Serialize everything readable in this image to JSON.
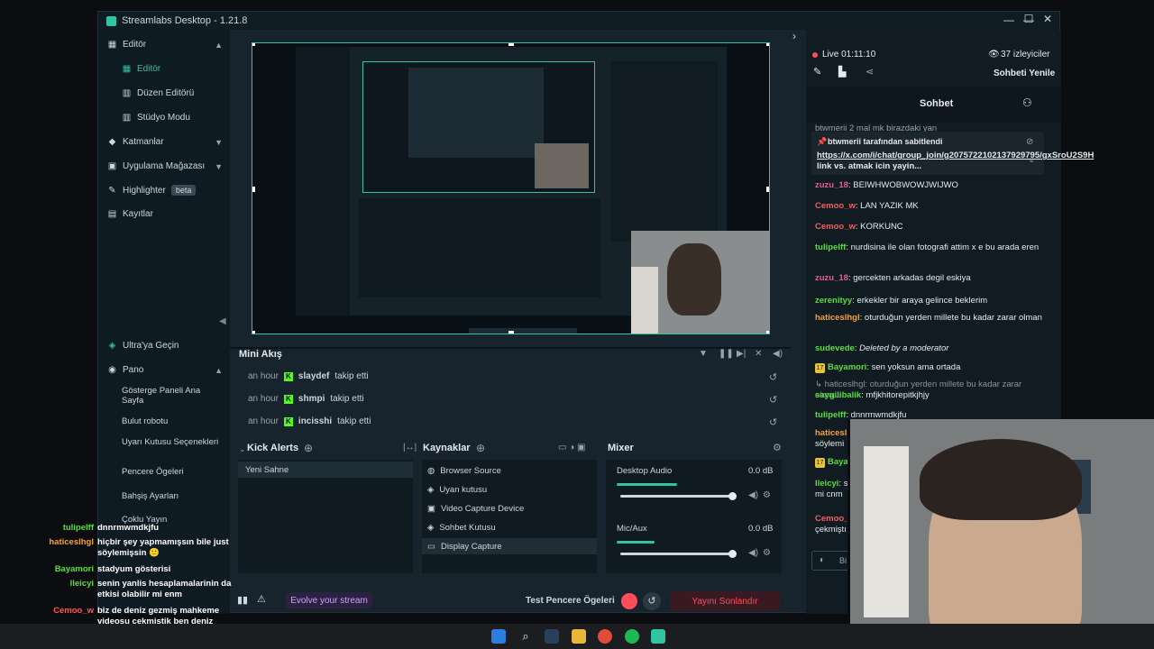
{
  "window": {
    "title": "Streamlabs Desktop - 1.21.8"
  },
  "sidebar": {
    "items": [
      {
        "label": "Editör"
      },
      {
        "label": "Editör"
      },
      {
        "label": "Düzen Editörü"
      },
      {
        "label": "Stüdyo Modu"
      },
      {
        "label": "Katmanlar"
      },
      {
        "label": "Uygulama Mağazası"
      },
      {
        "label": "Highlighter",
        "badge": "beta"
      },
      {
        "label": "Kayıtlar"
      },
      {
        "label": "Ultra'ya Geçin"
      },
      {
        "label": "Pano"
      },
      {
        "label": "Gösterge Paneli Ana Sayfa"
      },
      {
        "label": "Bulut robotu"
      },
      {
        "label": "Uyarı Kutusu Seçenekleri"
      },
      {
        "label": "Pencere Ögeleri"
      },
      {
        "label": "Bahşiş Ayarları"
      },
      {
        "label": "Çoklu Yayın"
      }
    ]
  },
  "mini_feed": {
    "title": "Mini Akış",
    "rows": [
      {
        "time": "an hour",
        "name": "slaydef",
        "action": "takip etti"
      },
      {
        "time": "an hour",
        "name": "shmpi",
        "action": "takip etti"
      },
      {
        "time": "an hour",
        "name": "incisshi",
        "action": "takip etti"
      }
    ]
  },
  "scenes": {
    "title": "Kick Alerts",
    "items": [
      "Yeni Sahne"
    ]
  },
  "sources": {
    "title": "Kaynaklar",
    "items": [
      "Browser Source",
      "Uyan kutusu",
      "Video Capture Device",
      "Sohbet Kutusu",
      "Display Capture"
    ],
    "selected": 4
  },
  "mixer": {
    "title": "Mixer",
    "channels": [
      {
        "name": "Desktop Audio",
        "db": "0.0 dB",
        "level": 0.48
      },
      {
        "name": "Mic/Aux",
        "db": "0.0 dB",
        "level": 0.3
      }
    ]
  },
  "footer": {
    "evolve": "Evolve your stream",
    "test_widgets": "Test Pencere Ögeleri",
    "end_stream": "Yayını Sonlandır"
  },
  "chat": {
    "live": "Live 01:11:10",
    "viewers": "37 izleyiciler",
    "refresh": "Sohbeti Yenile",
    "title": "Sohbet",
    "pinned_top": "btwmerii 2 mal mk birazdaki yan",
    "pinned_by": "btwmerii tarafından sabitlendi",
    "pinned_link": "https://x.com/i/chat/group_join/g2075722102137929795/gxSroU2S9H",
    "pinned_rest": " link vs. atmak icin yayin...",
    "messages": [
      {
        "user": "zuzu_18",
        "color": "#e85d8f",
        "text": "BEIWHWOBWOWJWIJWO"
      },
      {
        "user": "Cemoo_w",
        "color": "#ff5a5a",
        "text": "LAN YAZIK MK"
      },
      {
        "user": "Cemoo_w",
        "color": "#ff5a5a",
        "text": "KORKUNC"
      },
      {
        "user": "tulipelff",
        "color": "#5bde3a",
        "text": "nurdisina ile olan fotografi attim x e bu arada eren"
      },
      {
        "user": "zuzu_18",
        "color": "#e85d8f",
        "text": "gercekten arkadas degil eskiya"
      },
      {
        "user": "zerenityy",
        "color": "#5bde3a",
        "text": "erkekler bir araya gelince beklerim"
      },
      {
        "user": "haticeslhgl",
        "color": "#f2a33a",
        "text": "oturduğun yerden millete bu kadar zarar olman"
      },
      {
        "user": "sudevede",
        "color": "#5bde3a",
        "text": "Deleted by a moderator"
      },
      {
        "user": "Bayamori",
        "color": "#5bde3a",
        "text": "sen yoksun ama ortada"
      },
      {
        "user": "",
        "color": "#8a949c",
        "text": "↳ haticeslhgl: oturduğun yerden millete bu kadar zarar olma..."
      },
      {
        "user": "saygilibalik",
        "color": "#5bde3a",
        "text": "mfjkhitorepitkjhjy"
      },
      {
        "user": "tulipelff",
        "color": "#5bde3a",
        "text": "dnnrmwmdkjfu"
      },
      {
        "user": "haticesl",
        "color": "#f2a33a",
        "text": ""
      },
      {
        "user": "",
        "color": "#e6eaee",
        "text": "söylemi"
      },
      {
        "user": "Baya",
        "color": "#5bde3a",
        "text": ""
      },
      {
        "user": "lleicyi",
        "color": "#5bde3a",
        "text": "s"
      },
      {
        "user": "",
        "color": "#e6eaee",
        "text": "mi cnm"
      },
      {
        "user": "Cemoo_",
        "color": "#ff5a5a",
        "text": ""
      },
      {
        "user": "",
        "color": "#e6eaee",
        "text": "çekmiştı"
      }
    ],
    "input_placeholder": "Bi"
  },
  "overlay_chat": [
    {
      "user": "tulipelff",
      "color": "#5bde3a",
      "text": "dnnrmwmdkjfu"
    },
    {
      "user": "haticeslhgl",
      "color": "#f2a33a",
      "text": "hiçbir şey yapmamışsın bile just söylemişsin 🙂"
    },
    {
      "user": "Bayamori",
      "color": "#5bde3a",
      "text": "stadyum gösterisi"
    },
    {
      "user": "lleicyi",
      "color": "#5bde3a",
      "text": "senin yanlis hesaplamalarinin da etkisi olabilir mi enm"
    },
    {
      "user": "Cemoo_w",
      "color": "#ff5a5a",
      "text": "biz de deniz gezmiş mahkeme videosu çekmiştik ben deniz gezmiş oldum priwimdeki en iyi st"
    }
  ],
  "colors": {
    "accent": "#31c3a2",
    "kick": "#53fc18",
    "danger": "#ff4d5a",
    "bg": "#17242d"
  }
}
